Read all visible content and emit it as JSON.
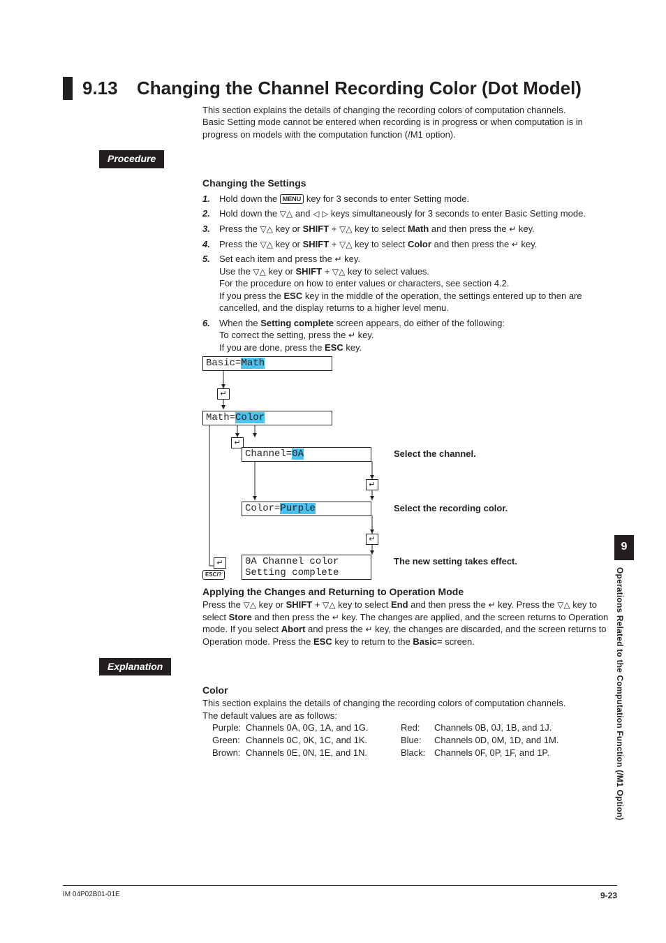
{
  "side": {
    "chapter_num": "9",
    "chapter_title": "Operations Related to the Computation Function (/M1 Option)"
  },
  "title": {
    "number": "9.13",
    "text": "Changing the Channel Recording Color (Dot Model)"
  },
  "intro": {
    "p1": "This section explains the details of changing the recording colors of computation channels.",
    "p2": "Basic Setting mode cannot be entered when recording is in progress or when computation is in progress on models with the computation function (/M1 option)."
  },
  "labels": {
    "procedure": "Procedure",
    "explanation": "Explanation"
  },
  "procedure": {
    "changing_heading": "Changing the Settings",
    "step1_a": "Hold down the ",
    "step1_key": "MENU",
    "step1_b": " key for 3 seconds to enter Setting mode.",
    "step2_a": "Hold down the ",
    "step2_b": " and ",
    "step2_c": " keys simultaneously for 3 seconds to enter Basic Setting mode.",
    "step3_a": "Press the ",
    "step3_b": " key or ",
    "step3_shift": "SHIFT",
    "step3_c": " + ",
    "step3_d": " key to select ",
    "step3_math": "Math",
    "step3_e": " and then press the ",
    "step3_f": " key.",
    "step4_a": "Press the ",
    "step4_b": " key or ",
    "step4_shift": "SHIFT",
    "step4_c": " + ",
    "step4_d": " key to select ",
    "step4_color": "Color",
    "step4_e": " and then press the ",
    "step4_f": " key.",
    "step5_a": "Set each item and press the ",
    "step5_b": " key.",
    "step5_c": "Use the ",
    "step5_d": " key or ",
    "step5_shift": "SHIFT",
    "step5_e": " + ",
    "step5_f": " key to select values.",
    "step5_g": "For the procedure on how to enter values or characters, see section 4.2.",
    "step5_h": "If you press the ",
    "step5_esc": "ESC",
    "step5_i": " key in the middle of the operation, the settings entered up to then are cancelled, and the display returns to a higher level menu.",
    "step6_a": "When the ",
    "step6_setting_complete": "Setting complete",
    "step6_b": " screen appears, do either of the following:",
    "step6_c": "To correct the setting, press the ",
    "step6_d": " key.",
    "step6_e": "If you are done, press the ",
    "step6_esc": "ESC",
    "step6_f": " key."
  },
  "diagram": {
    "lcd1_a": "Basic=",
    "lcd1_b": "Math",
    "lcd2_a": "Math=",
    "lcd2_b": "Color",
    "lcd3_a": "Channel=",
    "lcd3_b": "0A",
    "lcd4_a": "Color=",
    "lcd4_b": "Purple",
    "lcd5_a": "0A Channel color",
    "lcd5_b": "Setting complete",
    "esc_key": "ESC/?",
    "cap_channel": "Select the channel.",
    "cap_color": "Select the recording color.",
    "cap_effect": "The new setting takes effect."
  },
  "applying": {
    "heading": "Applying the Changes and Returning to Operation Mode",
    "a": "Press the ",
    "b": " key or ",
    "shift": "SHIFT",
    "c": " + ",
    "d": " key to select ",
    "end": "End",
    "e": " and then press the ",
    "f": " key. Press the ",
    "g": " key to select ",
    "store": "Store",
    "h": " and then press the ",
    "i": " key. The changes are applied, and the screen returns to Operation mode. If you select ",
    "abort": "Abort",
    "j": " and press the ",
    "k": " key, the changes are discarded, and the screen returns to Operation mode. Press the ",
    "esc": "ESC",
    "l": " key to return to the ",
    "basic": "Basic=",
    "m": " screen."
  },
  "explanation": {
    "heading": "Color",
    "p1": "This section explains the details of changing the recording colors of computation channels.",
    "p2": "The default values are as follows:",
    "rows": [
      {
        "c1": "Purple:",
        "v1": "Channels 0A, 0G, 1A, and 1G.",
        "c2": "Red:",
        "v2": "Channels 0B, 0J, 1B, and 1J."
      },
      {
        "c1": "Green:",
        "v1": "Channels 0C, 0K, 1C, and 1K.",
        "c2": "Blue:",
        "v2": "Channels 0D, 0M, 1D, and 1M."
      },
      {
        "c1": "Brown:",
        "v1": "Channels 0E, 0N, 1E, and 1N.",
        "c2": "Black:",
        "v2": "Channels 0F, 0P, 1F, and 1P."
      }
    ]
  },
  "footer": {
    "left": "IM 04P02B01-01E",
    "right": "9-23"
  },
  "glyphs": {
    "updown": "▽△",
    "leftright": "◁ ▷",
    "enter": "↵"
  }
}
